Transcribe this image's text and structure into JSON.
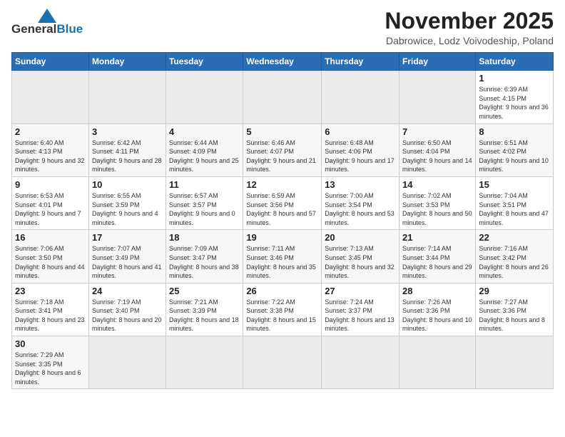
{
  "logo": {
    "line1": "General",
    "line2": "Blue"
  },
  "title": "November 2025",
  "subtitle": "Dabrowice, Lodz Voivodeship, Poland",
  "weekdays": [
    "Sunday",
    "Monday",
    "Tuesday",
    "Wednesday",
    "Thursday",
    "Friday",
    "Saturday"
  ],
  "weeks": [
    [
      {
        "day": "",
        "info": ""
      },
      {
        "day": "",
        "info": ""
      },
      {
        "day": "",
        "info": ""
      },
      {
        "day": "",
        "info": ""
      },
      {
        "day": "",
        "info": ""
      },
      {
        "day": "",
        "info": ""
      },
      {
        "day": "1",
        "info": "Sunrise: 6:39 AM\nSunset: 4:15 PM\nDaylight: 9 hours and 36 minutes."
      }
    ],
    [
      {
        "day": "2",
        "info": "Sunrise: 6:40 AM\nSunset: 4:13 PM\nDaylight: 9 hours and 32 minutes."
      },
      {
        "day": "3",
        "info": "Sunrise: 6:42 AM\nSunset: 4:11 PM\nDaylight: 9 hours and 28 minutes."
      },
      {
        "day": "4",
        "info": "Sunrise: 6:44 AM\nSunset: 4:09 PM\nDaylight: 9 hours and 25 minutes."
      },
      {
        "day": "5",
        "info": "Sunrise: 6:46 AM\nSunset: 4:07 PM\nDaylight: 9 hours and 21 minutes."
      },
      {
        "day": "6",
        "info": "Sunrise: 6:48 AM\nSunset: 4:06 PM\nDaylight: 9 hours and 17 minutes."
      },
      {
        "day": "7",
        "info": "Sunrise: 6:50 AM\nSunset: 4:04 PM\nDaylight: 9 hours and 14 minutes."
      },
      {
        "day": "8",
        "info": "Sunrise: 6:51 AM\nSunset: 4:02 PM\nDaylight: 9 hours and 10 minutes."
      }
    ],
    [
      {
        "day": "9",
        "info": "Sunrise: 6:53 AM\nSunset: 4:01 PM\nDaylight: 9 hours and 7 minutes."
      },
      {
        "day": "10",
        "info": "Sunrise: 6:55 AM\nSunset: 3:59 PM\nDaylight: 9 hours and 4 minutes."
      },
      {
        "day": "11",
        "info": "Sunrise: 6:57 AM\nSunset: 3:57 PM\nDaylight: 9 hours and 0 minutes."
      },
      {
        "day": "12",
        "info": "Sunrise: 6:59 AM\nSunset: 3:56 PM\nDaylight: 8 hours and 57 minutes."
      },
      {
        "day": "13",
        "info": "Sunrise: 7:00 AM\nSunset: 3:54 PM\nDaylight: 8 hours and 53 minutes."
      },
      {
        "day": "14",
        "info": "Sunrise: 7:02 AM\nSunset: 3:53 PM\nDaylight: 8 hours and 50 minutes."
      },
      {
        "day": "15",
        "info": "Sunrise: 7:04 AM\nSunset: 3:51 PM\nDaylight: 8 hours and 47 minutes."
      }
    ],
    [
      {
        "day": "16",
        "info": "Sunrise: 7:06 AM\nSunset: 3:50 PM\nDaylight: 8 hours and 44 minutes."
      },
      {
        "day": "17",
        "info": "Sunrise: 7:07 AM\nSunset: 3:49 PM\nDaylight: 8 hours and 41 minutes."
      },
      {
        "day": "18",
        "info": "Sunrise: 7:09 AM\nSunset: 3:47 PM\nDaylight: 8 hours and 38 minutes."
      },
      {
        "day": "19",
        "info": "Sunrise: 7:11 AM\nSunset: 3:46 PM\nDaylight: 8 hours and 35 minutes."
      },
      {
        "day": "20",
        "info": "Sunrise: 7:13 AM\nSunset: 3:45 PM\nDaylight: 8 hours and 32 minutes."
      },
      {
        "day": "21",
        "info": "Sunrise: 7:14 AM\nSunset: 3:44 PM\nDaylight: 8 hours and 29 minutes."
      },
      {
        "day": "22",
        "info": "Sunrise: 7:16 AM\nSunset: 3:42 PM\nDaylight: 8 hours and 26 minutes."
      }
    ],
    [
      {
        "day": "23",
        "info": "Sunrise: 7:18 AM\nSunset: 3:41 PM\nDaylight: 8 hours and 23 minutes."
      },
      {
        "day": "24",
        "info": "Sunrise: 7:19 AM\nSunset: 3:40 PM\nDaylight: 8 hours and 20 minutes."
      },
      {
        "day": "25",
        "info": "Sunrise: 7:21 AM\nSunset: 3:39 PM\nDaylight: 8 hours and 18 minutes."
      },
      {
        "day": "26",
        "info": "Sunrise: 7:22 AM\nSunset: 3:38 PM\nDaylight: 8 hours and 15 minutes."
      },
      {
        "day": "27",
        "info": "Sunrise: 7:24 AM\nSunset: 3:37 PM\nDaylight: 8 hours and 13 minutes."
      },
      {
        "day": "28",
        "info": "Sunrise: 7:26 AM\nSunset: 3:36 PM\nDaylight: 8 hours and 10 minutes."
      },
      {
        "day": "29",
        "info": "Sunrise: 7:27 AM\nSunset: 3:36 PM\nDaylight: 8 hours and 8 minutes."
      }
    ],
    [
      {
        "day": "30",
        "info": "Sunrise: 7:29 AM\nSunset: 3:35 PM\nDaylight: 8 hours and 6 minutes."
      },
      {
        "day": "",
        "info": ""
      },
      {
        "day": "",
        "info": ""
      },
      {
        "day": "",
        "info": ""
      },
      {
        "day": "",
        "info": ""
      },
      {
        "day": "",
        "info": ""
      },
      {
        "day": "",
        "info": ""
      }
    ]
  ]
}
